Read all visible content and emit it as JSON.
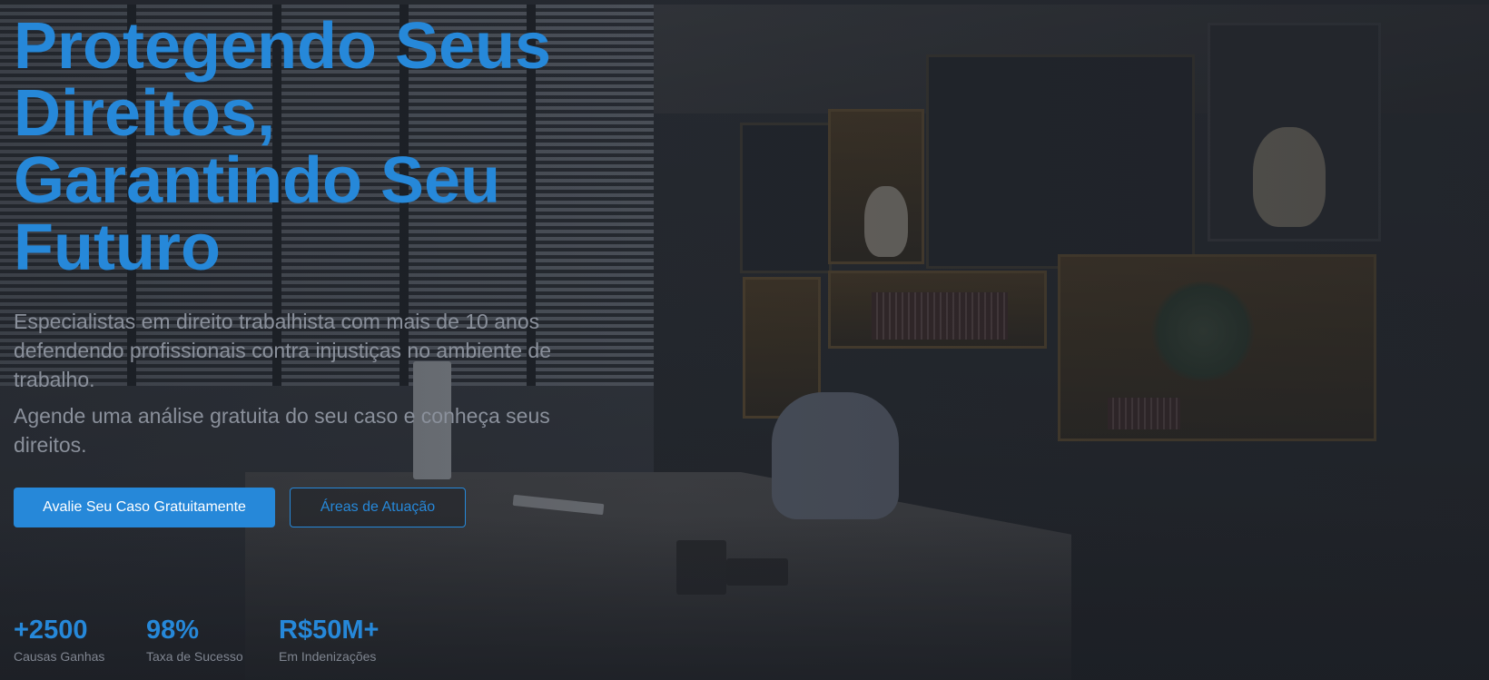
{
  "hero": {
    "title_lines": [
      "Protegendo Seus",
      "Direitos,",
      "Garantindo Seu",
      "Futuro"
    ],
    "subtitle": "Especialistas em direito trabalhista com mais de 10 anos defendendo profissionais contra injustiças no ambiente de trabalho.",
    "subtitle2": "Agende uma análise gratuita do seu caso e conheça seus direitos.",
    "primary_button": "Avalie Seu Caso Gratuitamente",
    "secondary_button": "Áreas de Atuação"
  },
  "stats": [
    {
      "value": "+2500",
      "label": "Causas Ganhas"
    },
    {
      "value": "98%",
      "label": "Taxa de Sucesso"
    },
    {
      "value": "R$50M+",
      "label": "Em Indenizações"
    }
  ],
  "colors": {
    "accent": "#2688d9",
    "muted_text": "#8a909b",
    "background": "#22262d"
  }
}
